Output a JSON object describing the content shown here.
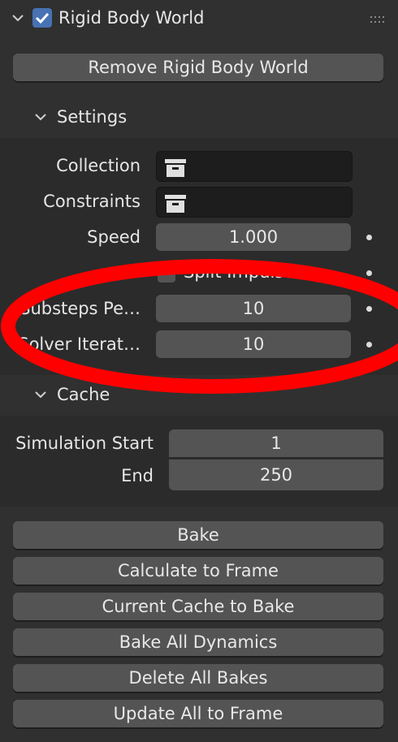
{
  "panel": {
    "title": "Rigid Body World",
    "enabled": true,
    "remove_button": "Remove Rigid Body World"
  },
  "settings": {
    "title": "Settings",
    "collection_label": "Collection",
    "collection_value": "",
    "constraints_label": "Constraints",
    "constraints_value": "",
    "speed_label": "Speed",
    "speed_value": "1.000",
    "split_impulse_label": "Split Impulse",
    "split_impulse_checked": false,
    "substeps_label": "Substeps Pe…",
    "substeps_value": "10",
    "solver_label": "Solver Iterat…",
    "solver_value": "10"
  },
  "cache": {
    "title": "Cache",
    "sim_start_label": "Simulation Start",
    "sim_start_value": "1",
    "end_label": "End",
    "end_value": "250"
  },
  "bake_buttons": {
    "bake": "Bake",
    "calculate": "Calculate to Frame",
    "current_cache": "Current Cache to Bake",
    "bake_all": "Bake All Dynamics",
    "delete_all": "Delete All Bakes",
    "update_all": "Update All to Frame"
  },
  "colors": {
    "background": "#303030",
    "subpanel": "#2b2b2b",
    "button": "#545454",
    "checkbox_accent": "#4772b3",
    "annotation": "#ff0000"
  },
  "icons": {
    "header_chevron": "chevron-down-icon",
    "drag_handle": "grip-icon",
    "collection_field": "collection-box-icon"
  }
}
